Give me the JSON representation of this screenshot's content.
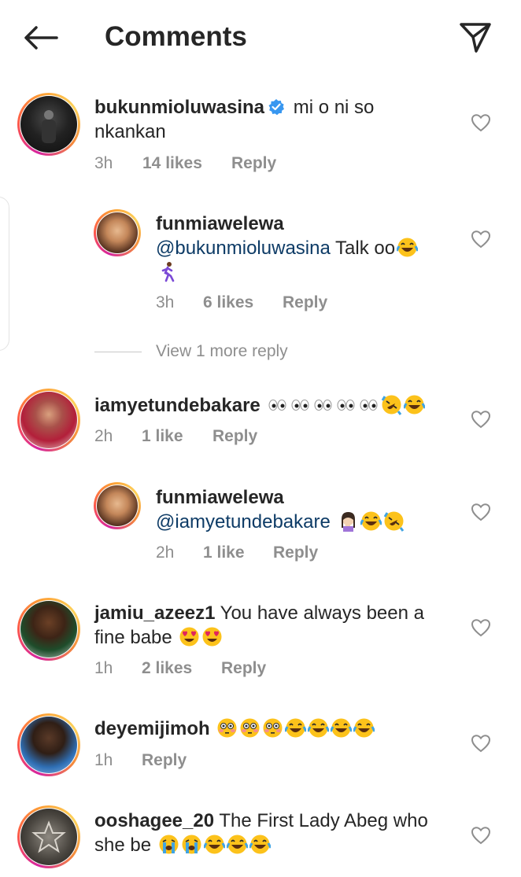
{
  "header": {
    "title": "Comments",
    "back_icon": "arrow-left-icon",
    "send_icon": "send-paper-plane-icon"
  },
  "comments": [
    {
      "username": "bukunmioluwasina",
      "verified": true,
      "text_line1": "mi o ni so",
      "text_line2": "nkankan",
      "time": "3h",
      "likes": "14 likes",
      "reply": "Reply"
    },
    {
      "username": "funmiawelewa",
      "mention": "@bukunmioluwasina",
      "text": "Talk oo",
      "time": "3h",
      "likes": "6 likes",
      "reply": "Reply"
    },
    {
      "view_more": "View 1 more reply"
    },
    {
      "username": "iamyetundebakare",
      "time": "2h",
      "likes": "1 like",
      "reply": "Reply"
    },
    {
      "username": "funmiawelewa",
      "mention": "@iamyetundebakare",
      "time": "2h",
      "likes": "1 like",
      "reply": "Reply"
    },
    {
      "username": "jamiu_azeez1",
      "text_line1": "You have always been a",
      "text_line2": "fine babe",
      "time": "1h",
      "likes": "2 likes",
      "reply": "Reply"
    },
    {
      "username": "deyemijimoh",
      "time": "1h",
      "reply": "Reply"
    },
    {
      "username": "ooshagee_20",
      "text_line1": "The First Lady Abeg who",
      "text_line2": "she be"
    }
  ],
  "colors": {
    "text": "#262626",
    "meta": "#8e8e8e",
    "mention": "#0d3b66",
    "verified": "#3897f0"
  }
}
